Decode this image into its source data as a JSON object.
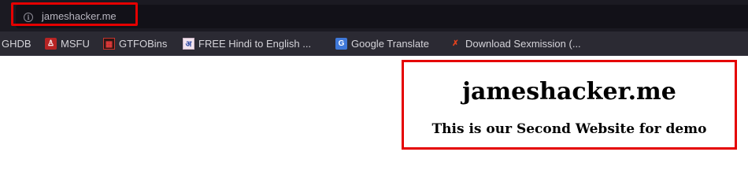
{
  "browser": {
    "url": "jameshacker.me",
    "info_icon": "info-icon"
  },
  "bookmarks": [
    {
      "label": "GHDB",
      "icon": ""
    },
    {
      "label": "MSFU",
      "icon": "msfu-icon"
    },
    {
      "label": "GTFOBins",
      "icon": "gtfobins-icon"
    },
    {
      "label": "FREE Hindi to English ...",
      "icon": "hindi-icon"
    },
    {
      "label": "Google Translate",
      "icon": "google-translate-icon"
    },
    {
      "label": "Download Sexmission (...",
      "icon": "download-icon"
    }
  ],
  "page": {
    "title": "jameshacker.me",
    "subtitle": "This is our Second Website for demo"
  },
  "colors": {
    "highlight": "#e50000",
    "toolbar_bg": "#1b1a22",
    "bookmarks_bg": "#2b2a33"
  }
}
